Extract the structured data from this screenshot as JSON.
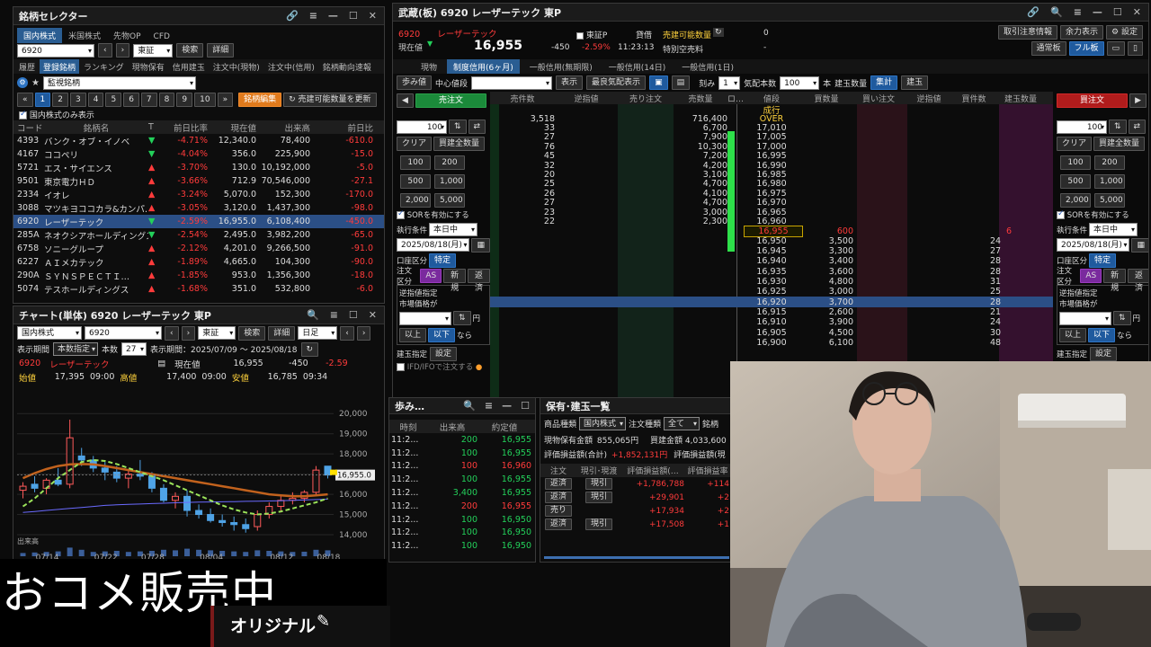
{
  "sel": {
    "title": "銘柄セレクター",
    "tabs": [
      "国内株式",
      "米国株式",
      "先物OP",
      "CFD"
    ],
    "code": "6920",
    "market": "東証",
    "btn_search": "検索",
    "btn_detail": "詳細",
    "subtabs": [
      "履歴",
      "登録銘柄",
      "ランキング",
      "現物保有",
      "信用建玉",
      "注文中(現物)",
      "注文中(信用)",
      "銘柄動向速報"
    ],
    "list_name": "監視銘柄",
    "pages": [
      "1",
      "2",
      "3",
      "4",
      "5",
      "6",
      "7",
      "8",
      "9",
      "10"
    ],
    "btn_edit": "銘柄編集",
    "btn_update": "売建可能数量を更新",
    "only_domestic": "国内株式のみ表示",
    "cols": [
      "コード",
      "銘柄名",
      "T",
      "前日比率",
      "現在値",
      "出来高",
      "前日比"
    ],
    "rows": [
      {
        "code": "4393",
        "name": "バンク・オブ・イノベ",
        "dir": "down",
        "pct": "-4.71%",
        "price": "12,340.0",
        "vol": "78,400",
        "chg": "-610.0"
      },
      {
        "code": "4167",
        "name": "ココペリ",
        "dir": "down",
        "pct": "-4.04%",
        "price": "356.0",
        "vol": "225,900",
        "chg": "-15.0"
      },
      {
        "code": "5721",
        "name": "エス・サイエンス",
        "dir": "up",
        "pct": "-3.70%",
        "price": "130.0",
        "vol": "10,192,000",
        "chg": "-5.0"
      },
      {
        "code": "9501",
        "name": "東京電力ＨＤ",
        "dir": "up",
        "pct": "-3.66%",
        "price": "712.9",
        "vol": "70,546,000",
        "chg": "-27.1"
      },
      {
        "code": "2334",
        "name": "イオレ",
        "dir": "up",
        "pct": "-3.24%",
        "price": "5,070.0",
        "vol": "152,300",
        "chg": "-170.0"
      },
      {
        "code": "3088",
        "name": "マツキヨココカラ&カンパ…",
        "dir": "up",
        "pct": "-3.05%",
        "price": "3,120.0",
        "vol": "1,437,300",
        "chg": "-98.0"
      },
      {
        "code": "6920",
        "name": "レーザーテック",
        "dir": "down",
        "pct": "-2.59%",
        "price": "16,955.0",
        "vol": "6,108,400",
        "chg": "-450.0"
      },
      {
        "code": "285A",
        "name": "ネオクシアホールディングス",
        "dir": "down",
        "pct": "-2.54%",
        "price": "2,495.0",
        "vol": "3,982,200",
        "chg": "-65.0"
      },
      {
        "code": "6758",
        "name": "ソニーグループ",
        "dir": "up",
        "pct": "-2.12%",
        "price": "4,201.0",
        "vol": "9,266,500",
        "chg": "-91.0"
      },
      {
        "code": "6227",
        "name": "ＡＩメカテック",
        "dir": "up",
        "pct": "-1.89%",
        "price": "4,665.0",
        "vol": "104,300",
        "chg": "-90.0"
      },
      {
        "code": "290A",
        "name": "ＳＹＮＳＰＥＣＴＩ…",
        "dir": "up",
        "pct": "-1.85%",
        "price": "953.0",
        "vol": "1,356,300",
        "chg": "-18.0"
      },
      {
        "code": "5074",
        "name": "テスホールディングス",
        "dir": "up",
        "pct": "-1.68%",
        "price": "351.0",
        "vol": "532,800",
        "chg": "-6.0"
      }
    ]
  },
  "chart": {
    "title": "チャート(単体) 6920 レーザーテック 東P",
    "market_type": "国内株式",
    "code": "6920",
    "exch": "東証",
    "btn_search": "検索",
    "btn_detail": "詳細",
    "period_type": "日足",
    "period_label": "表示期間",
    "period_sel": "本数指定",
    "count_label": "本数",
    "count": "27",
    "period_text": "表示期間：2025/07/09 ～ 2025/08/18",
    "code_name": "6920",
    "name": "レーザーテック",
    "now_label": "現在値",
    "now": "16,955",
    "chg": "-450",
    "pct": "-2.59",
    "open_label": "始値",
    "open": "17,395",
    "open_t": "09:00",
    "high_label": "高値",
    "high": "17,400",
    "high_t": "09:00",
    "low_label": "安値",
    "low": "16,785",
    "low_t": "09:34",
    "price_tag": "16,955.0",
    "vol_label": "出来高"
  },
  "chart_data": {
    "type": "candlestick",
    "x_ticks": [
      "07/14",
      "07/22",
      "07/28",
      "08/04",
      "08/12",
      "08/18"
    ],
    "y_ticks": [
      "20,000",
      "19,000",
      "18,000",
      "17,000",
      "16,000",
      "15,000",
      "14,000"
    ],
    "ylim": [
      14000,
      20500
    ],
    "candles": [
      [
        16200,
        16600,
        15800,
        16400
      ],
      [
        16500,
        16900,
        16100,
        16300
      ],
      [
        16300,
        16800,
        16000,
        16700
      ],
      [
        16700,
        17300,
        16400,
        16500
      ],
      [
        16500,
        19700,
        16300,
        18800
      ],
      [
        17900,
        18300,
        17400,
        17700
      ],
      [
        17700,
        17900,
        17100,
        17300
      ],
      [
        17300,
        17600,
        16700,
        17100
      ],
      [
        17100,
        17400,
        16600,
        16800
      ],
      [
        16800,
        17200,
        16300,
        17000
      ],
      [
        17000,
        17700,
        16700,
        16900
      ],
      [
        16900,
        17100,
        16100,
        16300
      ],
      [
        16300,
        16500,
        15600,
        15700
      ],
      [
        15700,
        16100,
        15300,
        15900
      ],
      [
        15900,
        16200,
        14900,
        15200
      ],
      [
        15200,
        15500,
        14800,
        15000
      ],
      [
        15000,
        15300,
        14600,
        14700
      ],
      [
        14700,
        15000,
        14400,
        14600
      ],
      [
        14600,
        14900,
        14200,
        14500
      ],
      [
        14500,
        14800,
        14100,
        14300
      ],
      [
        14400,
        15200,
        14200,
        15000
      ],
      [
        15000,
        15600,
        14800,
        15400
      ],
      [
        15400,
        15900,
        15100,
        15700
      ],
      [
        15700,
        16100,
        15500,
        15800
      ],
      [
        15800,
        16200,
        15600,
        16100
      ],
      [
        16100,
        17400,
        15900,
        17200
      ],
      [
        17395,
        17400,
        16785,
        16955
      ]
    ],
    "ma_fast": [
      15400,
      15800,
      16300,
      16800,
      17200,
      17600,
      17700,
      17650,
      17500,
      17300,
      17100,
      16900,
      16700,
      16450,
      16200,
      15950,
      15700,
      15450,
      15250,
      15100,
      15000,
      15050,
      15150,
      15300,
      15450,
      15600,
      15800
    ],
    "ma_mid": [
      16800,
      17050,
      17250,
      17400,
      17480,
      17500,
      17480,
      17400,
      17300,
      17200,
      17100,
      17000,
      16900,
      16800,
      16700,
      16600,
      16500,
      16400,
      16300,
      16200,
      16100,
      16000,
      15950,
      15900,
      15900,
      15950,
      16000
    ],
    "ma_slow": [
      15100,
      15150,
      15200,
      15250,
      15300,
      15350,
      15400,
      15450,
      15480,
      15500,
      15520,
      15540,
      15560,
      15580,
      15600,
      15610,
      15620,
      15630,
      15640,
      15650,
      15660,
      15670,
      15680,
      15700,
      15720,
      15740,
      15760
    ],
    "volume": [
      30,
      35,
      40,
      45,
      80,
      60,
      40,
      45,
      50,
      40,
      45,
      50,
      60,
      55,
      70,
      60,
      55,
      50,
      45,
      40,
      55,
      50,
      45,
      40,
      42,
      60,
      55
    ]
  },
  "board": {
    "title": "武蔵(板) 6920 レーザーテック 東P",
    "code": "6920",
    "name": "レーザーテック",
    "exch": "東証P",
    "margin": "貸借",
    "avail_label": "売建可能数量",
    "avail_val": "0",
    "fee_label": "特別空売料",
    "fee_val": "-",
    "now_label": "現在値",
    "now": "16,955",
    "chg": "-450",
    "pct": "-2.59%",
    "time": "11:23:13",
    "top_btns": [
      "取引注意情報",
      "余力表示",
      "設定"
    ],
    "btn_normal": "通常板",
    "btn_full": "フル板",
    "tabs": [
      "現物",
      "制度信用(6ヶ月)",
      "一般信用(無期限)",
      "一般信用(14日)",
      "一般信用(1日)"
    ],
    "tool": {
      "ayumi": "歩み値",
      "center": "中心値段",
      "show": "表示",
      "best": "最良気配表示",
      "tick": "刻み",
      "tick_val": "1",
      "qty": "気配本数",
      "qty_val": "100",
      "unit": "本",
      "pos": "建玉数量",
      "sum": "集計",
      "pos2": "建玉"
    },
    "sell_label": "売注文",
    "buy_label": "買注文",
    "cols": [
      "売件数",
      "逆指値",
      "売り注文",
      "売数量",
      "値段",
      "買数量",
      "買い注文",
      "逆指値",
      "買件数",
      "建玉数量"
    ],
    "left_form": {
      "qty": "100",
      "clear": "クリア",
      "all": "買建全数量",
      "b100": "100",
      "b200": "200",
      "b500": "500",
      "b1000": "1,000",
      "b2000": "2,000",
      "b5000": "5,000",
      "sor": "SORを有効にする",
      "cond_label": "執行条件",
      "cond": "本日中",
      "date": "2025/08/18(月)",
      "acct_label": "口座区分",
      "acct": "特定",
      "kind_label": "注文区分",
      "kind_as": "AS",
      "kind_new": "新規",
      "kind_rep": "返済",
      "stop_label": "逆指値指定",
      "mkt_label": "市場価格が",
      "yen": "円",
      "up": "以上",
      "down": "以下",
      "nara": "なら",
      "pos_label": "建玉指定",
      "pos_btn": "設定",
      "ifd": "IFD/IFOで注文する"
    },
    "asks": [
      {
        "cnt": "",
        "qty": "",
        "price": "成行"
      },
      {
        "cnt": "3,518",
        "qty": "716,400",
        "price": "OVER"
      },
      {
        "cnt": "33",
        "qty": "6,700",
        "price": "17,010"
      },
      {
        "cnt": "27",
        "qty": "7,900",
        "price": "17,005"
      },
      {
        "cnt": "76",
        "qty": "10,300",
        "price": "17,000"
      },
      {
        "cnt": "45",
        "qty": "7,200",
        "price": "16,995"
      },
      {
        "cnt": "32",
        "qty": "4,200",
        "price": "16,990"
      },
      {
        "cnt": "20",
        "qty": "3,100",
        "price": "16,985"
      },
      {
        "cnt": "25",
        "qty": "4,700",
        "price": "16,980"
      },
      {
        "cnt": "26",
        "qty": "4,100",
        "price": "16,975"
      },
      {
        "cnt": "27",
        "qty": "4,700",
        "price": "16,970"
      },
      {
        "cnt": "23",
        "qty": "3,000",
        "price": "16,965"
      },
      {
        "cnt": "22",
        "qty": "2,300",
        "price": "16,960"
      }
    ],
    "cur": {
      "price": "16,955",
      "qty": "600",
      "cnt": "6"
    },
    "bids": [
      {
        "price": "16,950",
        "qty": "3,500",
        "cnt": "24"
      },
      {
        "price": "16,945",
        "qty": "3,300",
        "cnt": "27"
      },
      {
        "price": "16,940",
        "qty": "3,400",
        "cnt": "28"
      },
      {
        "price": "16,935",
        "qty": "3,600",
        "cnt": "28"
      },
      {
        "price": "16,930",
        "qty": "4,800",
        "cnt": "31"
      },
      {
        "price": "16,925",
        "qty": "3,000",
        "cnt": "25"
      },
      {
        "price": "16,920",
        "qty": "3,700",
        "cnt": "28"
      },
      {
        "price": "16,915",
        "qty": "2,600",
        "cnt": "21"
      },
      {
        "price": "16,910",
        "qty": "3,900",
        "cnt": "24"
      },
      {
        "price": "16,905",
        "qty": "4,500",
        "cnt": "30"
      },
      {
        "price": "16,900",
        "qty": "6,100",
        "cnt": "48"
      }
    ]
  },
  "ayumi": {
    "title": "歩み…",
    "cols": [
      "時刻",
      "出来高",
      "約定値"
    ],
    "rows": [
      {
        "t": "11:2...",
        "v": "200",
        "p": "16,955",
        "c": "grn"
      },
      {
        "t": "11:2...",
        "v": "100",
        "p": "16,955",
        "c": "grn"
      },
      {
        "t": "11:2...",
        "v": "100",
        "p": "16,960",
        "c": "red"
      },
      {
        "t": "11:2...",
        "v": "100",
        "p": "16,955",
        "c": "grn"
      },
      {
        "t": "11:2...",
        "v": "3,400",
        "p": "16,955",
        "c": "grn"
      },
      {
        "t": "11:2...",
        "v": "200",
        "p": "16,955",
        "c": "red"
      },
      {
        "t": "11:2...",
        "v": "100",
        "p": "16,950",
        "c": "grn"
      },
      {
        "t": "11:2...",
        "v": "100",
        "p": "16,950",
        "c": "grn"
      },
      {
        "t": "11:2...",
        "v": "100",
        "p": "16,950",
        "c": "grn"
      }
    ]
  },
  "hold": {
    "title": "保有･建玉一覧",
    "kind_label": "商品種類",
    "kind": "国内株式",
    "type_label": "注文種類",
    "type": "全て",
    "brand_label": "銘柄",
    "cash_label": "現物保有金額",
    "cash": "855,065円",
    "buy_label": "買建金額",
    "buy": "4,033,600",
    "pnl_label": "評価損益額(合計)",
    "pnl": "+1,852,131円",
    "pnl2_label": "評価損益額(現",
    "cols": [
      "注文",
      "現引･現渡",
      "評価損益額(…",
      "評価損益率"
    ],
    "rows": [
      {
        "a": "返済",
        "b": "現引",
        "pnl": "+1,786,788",
        "r": "+114"
      },
      {
        "a": "返済",
        "b": "現引",
        "pnl": "+29,901",
        "r": "+2"
      },
      {
        "a": "売り",
        "b": "",
        "pnl": "+17,934",
        "r": "+2"
      },
      {
        "a": "返済",
        "b": "現引",
        "pnl": "+17,508",
        "r": "+1"
      }
    ]
  },
  "overlay": {
    "caption": "おコメ販売中",
    "original": "オリジナル"
  }
}
